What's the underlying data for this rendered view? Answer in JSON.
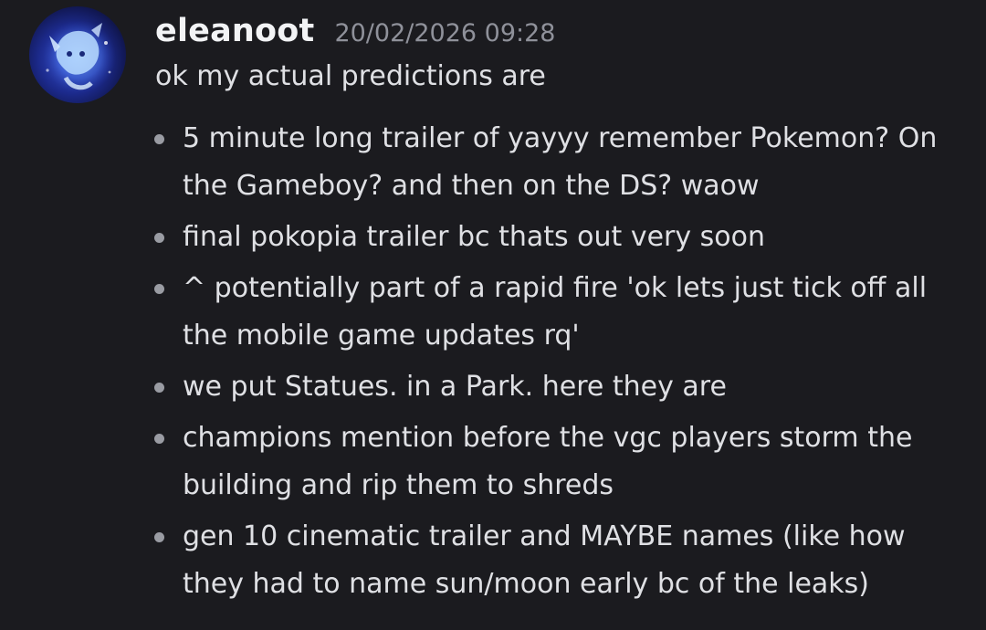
{
  "message": {
    "username": "eleanoot",
    "timestamp": "20/02/2026 09:28",
    "intro": "ok my actual predictions are",
    "items": [
      {
        "text": "5 minute long trailer of yayyy remember Pokemon? On the Gameboy? and then on the DS? waow"
      },
      {
        "text": "final pokopia trailer bc thats out very soon"
      },
      {
        "text": "^ potentially part of a rapid fire 'ok lets just tick off all the mobile game updates rq'"
      },
      {
        "text": "we put Statues. in a Park. here they are"
      },
      {
        "text": "champions mention before the vgc players storm the building and rip them to shreds"
      },
      {
        "text": "gen 10 cinematic trailer and MAYBE names (like how they had to name sun/moon early bc of the leaks)"
      }
    ]
  },
  "colors": {
    "background": "#1b1b1f",
    "username": "#f2f3f5",
    "timestamp": "#8f919a",
    "text": "#dfe0e4",
    "avatar_accent": "#3a57d8"
  },
  "icons": {
    "avatar": "user-avatar-image",
    "bullet": "bullet-dot"
  }
}
